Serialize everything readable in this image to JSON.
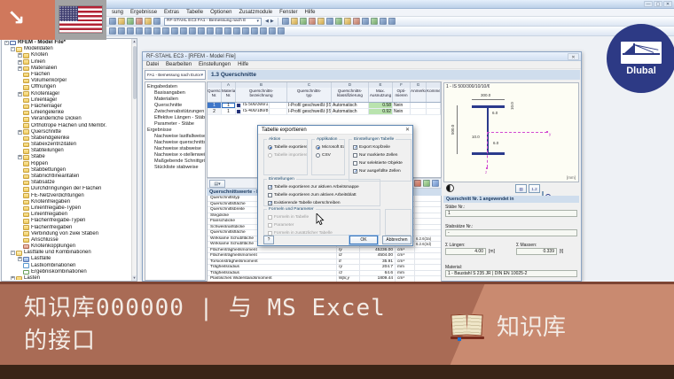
{
  "colors": {
    "banner_dark": "#a96b55",
    "banner_light": "#c98a70",
    "banner_line": "#7c4433",
    "banner_strip": "#3a2517",
    "overlay_orange": "#d0785c",
    "brand_navy": "#2d3a85",
    "header_blue": "#cfdded",
    "selection": "#3e76c8",
    "ok_green": "#b9e3ae"
  },
  "glyphs": {
    "min": "—",
    "max": "▢",
    "close": "✕",
    "caret": "▾",
    "up": "▲",
    "down": "▼",
    "back": "◀",
    "fwd": "▶",
    "arrow": "↘",
    "help": "?",
    "section": "I",
    "dots": "1.2"
  },
  "main_window": {
    "menu": [
      "sung",
      "Ergebnisse",
      "Extras",
      "Tabelle",
      "Optionen",
      "Zusatzmodule",
      "Fenster",
      "Hilfe"
    ],
    "toolbar_case": "RF-STAHL EC3 FA1 - Bemessung nach E",
    "toolbar1_left": [
      "new-icon",
      "open-icon",
      "save-icon",
      "print-icon",
      "copy-icon",
      "undo-icon"
    ],
    "toolbar1_right": [
      "back-icon",
      "forward-icon",
      "render-icon",
      "move-icon",
      "zoom-icon",
      "view-icon",
      "mail-icon",
      "excel-icon",
      "tables-icon",
      "display-icon",
      "settings-icon",
      "layers-icon",
      "help-icon"
    ],
    "toolbar2": [
      "select-icon",
      "node-icon",
      "line-icon",
      "surface-icon",
      "opening-icon",
      "support-icon",
      "hinge-icon",
      "member-icon",
      "loadcase-icon",
      "load-icon",
      "mesh-icon",
      "calc-icon",
      "results-icon",
      "deform-icon",
      "forces-icon",
      "stress-icon",
      "printout-icon",
      "clipboard-icon",
      "units-icon",
      "config-icon"
    ],
    "tree": [
      {
        "t": "RFEM - Model File*",
        "exp": "-",
        "cls": "lvl0 ic-app"
      },
      {
        "t": "Modelldaten",
        "exp": "-",
        "cls": "lvl1 ic-fo"
      },
      {
        "t": "Knoten",
        "exp": "+",
        "cls": "lvl2 ic-f"
      },
      {
        "t": "Linien",
        "exp": "+",
        "cls": "lvl2 ic-f"
      },
      {
        "t": "Materialien",
        "exp": "+",
        "cls": "lvl2 ic-f"
      },
      {
        "t": "Flächen",
        "exp": "",
        "cls": "lvl2 ic-f"
      },
      {
        "t": "Volumenkörper",
        "exp": "",
        "cls": "lvl2 ic-f"
      },
      {
        "t": "Öffnungen",
        "exp": "",
        "cls": "lvl2 ic-f"
      },
      {
        "t": "Knotenlager",
        "exp": "+",
        "cls": "lvl2 ic-f"
      },
      {
        "t": "Linienlager",
        "exp": "",
        "cls": "lvl2 ic-f"
      },
      {
        "t": "Flächenlager",
        "exp": "",
        "cls": "lvl2 ic-f"
      },
      {
        "t": "Liniengelenke",
        "exp": "",
        "cls": "lvl2 ic-f"
      },
      {
        "t": "Veränderliche Dicken",
        "exp": "",
        "cls": "lvl2 ic-f"
      },
      {
        "t": "Orthotrope Flächen und Membr.",
        "exp": "",
        "cls": "lvl2 ic-f"
      },
      {
        "t": "Querschnitte",
        "exp": "+",
        "cls": "lvl2 ic-f"
      },
      {
        "t": "Stabendgelenke",
        "exp": "",
        "cls": "lvl2 ic-f"
      },
      {
        "t": "Stabexzentrizitäten",
        "exp": "",
        "cls": "lvl2 ic-f"
      },
      {
        "t": "Stabteilungen",
        "exp": "",
        "cls": "lvl2 ic-f"
      },
      {
        "t": "Stäbe",
        "exp": "+",
        "cls": "lvl2 ic-f"
      },
      {
        "t": "Rippen",
        "exp": "",
        "cls": "lvl2 ic-f"
      },
      {
        "t": "Stabbettungen",
        "exp": "",
        "cls": "lvl2 ic-f"
      },
      {
        "t": "Stabnichtlinearitäten",
        "exp": "",
        "cls": "lvl2 ic-f"
      },
      {
        "t": "Stabsätze",
        "exp": "",
        "cls": "lvl2 ic-f"
      },
      {
        "t": "Durchdringungen der Flächen",
        "exp": "",
        "cls": "lvl2 ic-f"
      },
      {
        "t": "FE-Netzverdichtungen",
        "exp": "",
        "cls": "lvl2 ic-f"
      },
      {
        "t": "Knotenfreigaben",
        "exp": "",
        "cls": "lvl2 ic-f"
      },
      {
        "t": "Linienfreigabe-Typen",
        "exp": "",
        "cls": "lvl2 ic-f"
      },
      {
        "t": "Linienfreigaben",
        "exp": "",
        "cls": "lvl2 ic-f"
      },
      {
        "t": "Flächenfreigabe-Typen",
        "exp": "",
        "cls": "lvl2 ic-f"
      },
      {
        "t": "Flächenfreigaben",
        "exp": "",
        "cls": "lvl2 ic-f"
      },
      {
        "t": "Verbindung von zwei Stäben",
        "exp": "",
        "cls": "lvl2 ic-f"
      },
      {
        "t": "Anschlüsse",
        "exp": "",
        "cls": "lvl2 ic-f"
      },
      {
        "t": "Knotenkopplungen",
        "exp": "",
        "cls": "lvl2 ic-fx"
      },
      {
        "t": "Lastfälle und Kombinationen",
        "exp": "-",
        "cls": "lvl1 ic-fo"
      },
      {
        "t": "Lastfälle",
        "exp": "+",
        "cls": "lvl2 ic-lf"
      },
      {
        "t": "Lastkombinationen",
        "exp": "",
        "cls": "lvl2 ic-lk"
      },
      {
        "t": "Ergebniskombinationen",
        "exp": "",
        "cls": "lvl2 ic-ek"
      },
      {
        "t": "Lasten",
        "exp": "+",
        "cls": "lvl1 ic-f"
      }
    ]
  },
  "module": {
    "title": "RF-STAHL EC3 - [RFEM - Model File]",
    "menu": [
      "Datei",
      "Bearbeiten",
      "Einstellungen",
      "Hilfe"
    ],
    "case_dropdown": "FA1 - Bemessung nach Eurocod",
    "section_header": "1.3 Querschnitte",
    "nav": [
      {
        "t": "Eingabedaten",
        "cls": "root"
      },
      {
        "t": "Basisangaben",
        "cls": "child"
      },
      {
        "t": "Materialien",
        "cls": "child"
      },
      {
        "t": "Querschnitte",
        "cls": "child"
      },
      {
        "t": "Zwischenabstützungen",
        "cls": "child"
      },
      {
        "t": "Effektive Längen - Stäbe",
        "cls": "child"
      },
      {
        "t": "Parameter - Stäbe",
        "cls": "child"
      },
      {
        "t": "Ergebnisse",
        "cls": "root"
      },
      {
        "t": "Nachweise lastfallweise",
        "cls": "child"
      },
      {
        "t": "Nachweise querschnittsweise",
        "cls": "child"
      },
      {
        "t": "Nachweise stabweise",
        "cls": "child"
      },
      {
        "t": "Nachweise x-stellenweise",
        "cls": "child"
      },
      {
        "t": "Maßgebende Schnittgrößen sta",
        "cls": "child"
      },
      {
        "t": "Stückliste stabweise",
        "cls": "child"
      }
    ],
    "table": {
      "letters": [
        "",
        "A",
        "B",
        "C",
        "D",
        "E",
        "F",
        "G",
        ""
      ],
      "headers": [
        "Quersch.\nNr.",
        "Material\nNr.",
        "Querschnitts-\nbezeichnung",
        "Querschnitts-\ntyp",
        "Querschnitts-\nklassifizierung",
        "Max.\nAusnutzung",
        "Opti-\nmieren",
        "Anmerku",
        "Kommentar"
      ],
      "rows": [
        {
          "nr": "1",
          "mat": "1",
          "bez": "IS 500/300/1",
          "typ": "I-Profil geschweißt (IS",
          "kl": "Automatisch",
          "ausn": "0.58",
          "opt": "Nein",
          "anm": "",
          "kom": "",
          "cls": "sel"
        },
        {
          "nr": "2",
          "mat": "1",
          "bez": "IS 400/180/8",
          "typ": "I-Profil geschweißt (IS",
          "kl": "Automatisch",
          "ausn": "0.92",
          "opt": "Nein",
          "anm": "",
          "kom": ""
        }
      ]
    },
    "props_header": "Querschnittswerte - IS 50",
    "props": [
      {
        "l": "Querschnittstyp",
        "s": "",
        "v": "",
        "u": "",
        "r": ""
      },
      {
        "l": "Querschnittsfläche",
        "s": "",
        "v": "",
        "u": "",
        "r": ""
      },
      {
        "l": "Querschnittsbreite",
        "s": "",
        "v": "",
        "u": "",
        "r": ""
      },
      {
        "l": "Stegdicke",
        "s": "",
        "v": "",
        "u": "",
        "r": ""
      },
      {
        "l": "Flanschdicke",
        "s": "",
        "v": "",
        "u": "",
        "r": ""
      },
      {
        "l": "Schweißnahtdicke",
        "s": "",
        "v": "",
        "u": "",
        "r": ""
      },
      {
        "l": "Querschnittsfläche",
        "s": "",
        "v": "",
        "u": "",
        "r": ""
      },
      {
        "l": "Wirksame Schubfläche",
        "s": "",
        "v": "",
        "u": "",
        "r": "6.2.6(3a)"
      },
      {
        "l": "Wirksame Schubfläche",
        "s": "",
        "v": "",
        "u": "",
        "r": "6.2.6(3d)"
      },
      {
        "l": "Flächenträgheitsmoment",
        "s": "Iy",
        "v": "45236.00",
        "u": "cm⁴",
        "r": ""
      },
      {
        "l": "Flächenträgheitsmoment",
        "s": "Iz",
        "v": "4504.00",
        "u": "cm⁴",
        "r": ""
      },
      {
        "l": "Torsionsträgheitsmoment",
        "s": "It",
        "v": "35.91",
        "u": "cm⁴",
        "r": ""
      },
      {
        "l": "Trägheitsradius",
        "s": "ry",
        "v": "204.7",
        "u": "mm",
        "r": ""
      },
      {
        "l": "Trägheitsradius",
        "s": "rz",
        "v": "64.6",
        "u": "mm",
        "r": ""
      },
      {
        "l": "Plastisches Widerstandsmoment",
        "s": "Wpl,y",
        "v": "1809.44",
        "u": "cm³",
        "r": ""
      }
    ],
    "view": {
      "title": "1 - IS 500/300/10/10/6",
      "dim_width": "300.0",
      "dim_height": "500.0",
      "dim_tf": "10.0",
      "dim_tw": "10.0",
      "dim_weld": "6.0",
      "unit": "[mm]",
      "axis_y": "y",
      "axis_z": "z"
    },
    "info": {
      "header": "Querschnitt Nr. 1 angewendet in",
      "staebe_label": "Stäbe Nr.:",
      "staebe_val": "1",
      "stabsaetze_label": "Stabsätze Nr.:",
      "stabsaetze_val": "-",
      "laengen_label": "Σ Längen:",
      "laengen_val": "4.00",
      "laengen_unit": "[m]",
      "massen_label": "Σ Massen:",
      "massen_val": "0.339",
      "massen_unit": "[t]",
      "material_label": "Material:",
      "material_val": "1 - Baustahl S 235 JR | DIN EN 10025-2"
    }
  },
  "export_dialog": {
    "title": "Tabelle exportieren",
    "grp_aktion": "Aktion",
    "aktion": [
      {
        "t": "Tabelle exportieren",
        "cls": "on"
      },
      {
        "t": "Tabelle importieren",
        "cls": "dis"
      }
    ],
    "grp_applikation": "Applikation",
    "applikation": [
      {
        "t": "Microsoft Excel",
        "cls": "on"
      },
      {
        "t": "CSV",
        "cls": ""
      }
    ],
    "grp_tab": "Einstellungen Tabelle",
    "tab_settings": [
      {
        "t": "Export Kopfzeile",
        "cls": "on"
      },
      {
        "t": "Nur markierte Zellen",
        "cls": ""
      },
      {
        "t": "Nur selektierte Objekte",
        "cls": ""
      },
      {
        "t": "Nur ausgefüllte Zellen",
        "cls": "on"
      }
    ],
    "grp_settings": "Einstellungen",
    "settings": [
      {
        "t": "Tabelle exportieren zur aktiven Arbeitsmappe",
        "cls": "on"
      },
      {
        "t": "Tabelle exportieren zum aktiven Arbeitsblatt",
        "cls": ""
      },
      {
        "t": "Existierende Tabelle überschreiben",
        "cls": "on"
      }
    ],
    "grp_formeln": "Formeln und Parameter",
    "formeln": [
      {
        "t": "Formeln in Tabelle",
        "cls": "dis"
      },
      {
        "t": "Parameter",
        "cls": "dis"
      },
      {
        "t": "Formeln in zusätzlicher Tabelle",
        "cls": "dis"
      }
    ],
    "ok": "OK",
    "cancel": "Abbrechen",
    "help": "?"
  },
  "logo": {
    "text": "Dlubal"
  },
  "banner": {
    "title_line1": "知识库000000 | 与 MS Excel",
    "title_line2": "的接口",
    "badge": "知识库"
  }
}
